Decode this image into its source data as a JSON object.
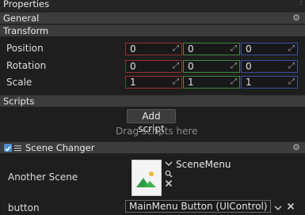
{
  "panel": {
    "title": "Properties"
  },
  "general": {
    "label": "General"
  },
  "transform": {
    "label": "Transform",
    "rows": [
      {
        "label": "Position",
        "values": [
          "0",
          "0",
          "0"
        ]
      },
      {
        "label": "Rotation",
        "values": [
          "0",
          "0",
          "0"
        ]
      },
      {
        "label": "Scale",
        "values": [
          "1",
          "1",
          "1"
        ]
      }
    ]
  },
  "scripts": {
    "label": "Scripts",
    "add_button": "Add script",
    "drop_hint": "Drag scripts here"
  },
  "scene_changer": {
    "label": "Scene Changer",
    "enabled": true,
    "another_scene": {
      "label": "Another Scene",
      "value": "SceneMenu"
    },
    "button": {
      "label": "button",
      "value": "MainMenu Button (UIControl)"
    }
  },
  "colors": {
    "background": "#1e1e1e",
    "header": "#3c3c3c",
    "axis_x": "#9a2f2f",
    "axis_y": "#3f8a3a",
    "axis_z": "#3b4fa0",
    "accent": "#4a90d9"
  }
}
